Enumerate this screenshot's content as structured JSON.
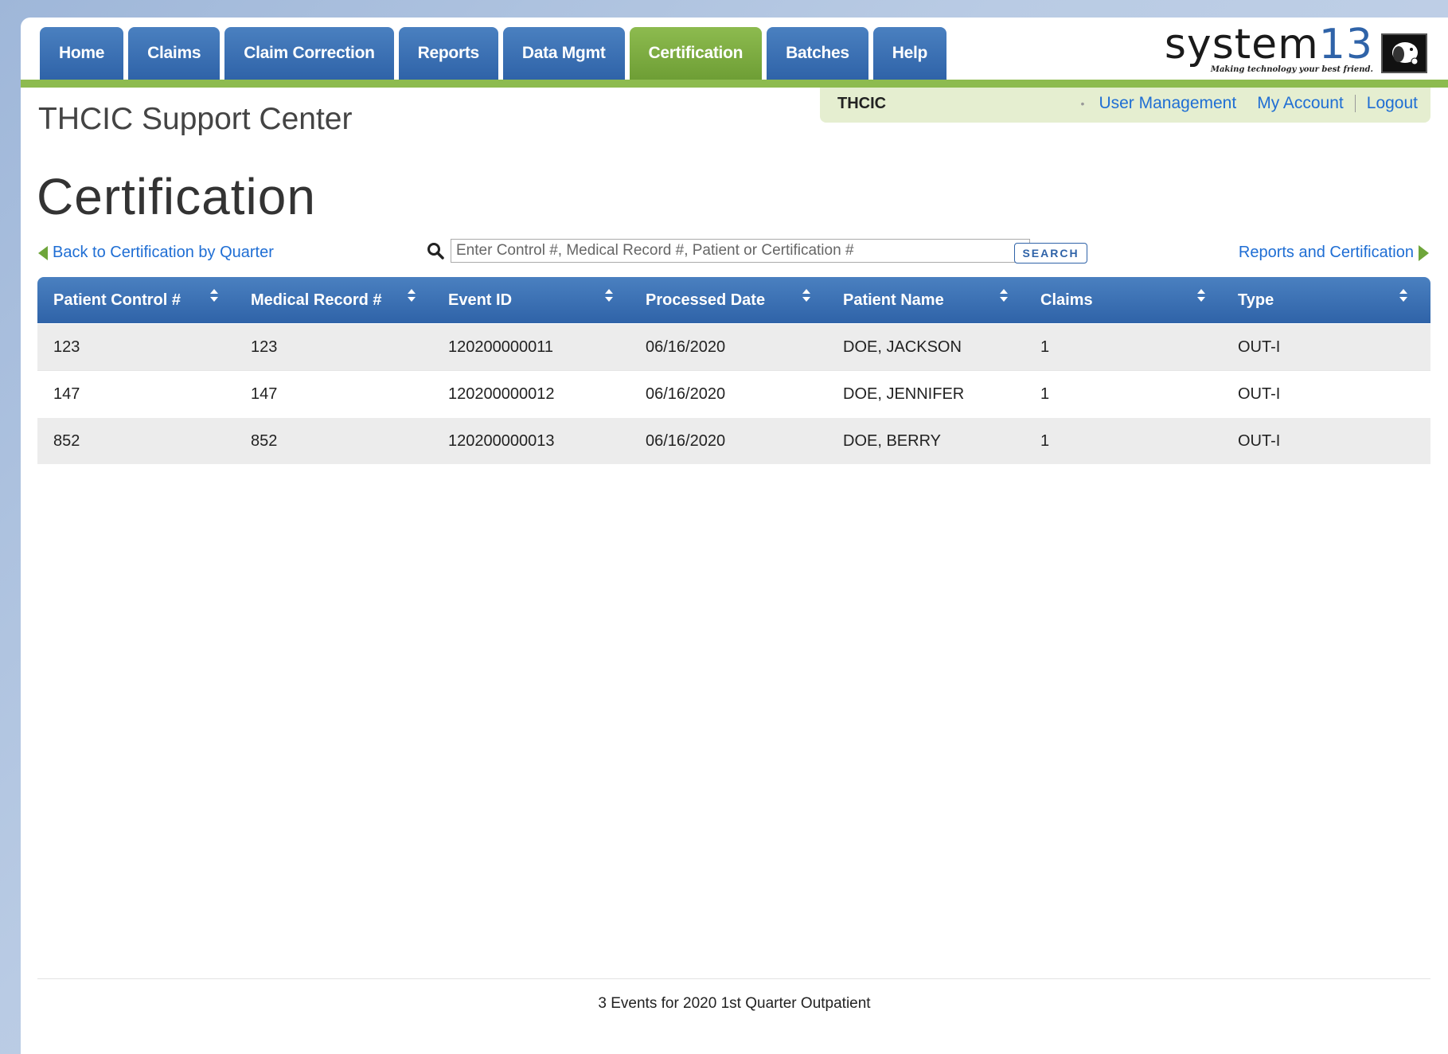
{
  "nav": {
    "tabs": [
      {
        "label": "Home",
        "active": false
      },
      {
        "label": "Claims",
        "active": false
      },
      {
        "label": "Claim Correction",
        "active": false
      },
      {
        "label": "Reports",
        "active": false
      },
      {
        "label": "Data Mgmt",
        "active": false
      },
      {
        "label": "Certification",
        "active": true
      },
      {
        "label": "Batches",
        "active": false
      },
      {
        "label": "Help",
        "active": false
      }
    ]
  },
  "logo": {
    "word": "system",
    "number": "13",
    "tagline": "Making technology your best friend.",
    "icon": "dog-logo-icon"
  },
  "userbar": {
    "org": "THCIC",
    "user_management": "User Management",
    "my_account": "My Account",
    "logout": "Logout"
  },
  "site_title": "THCIC Support Center",
  "page_title": "Certification",
  "toolbar": {
    "back_link": "Back to Certification by Quarter",
    "search_placeholder": "Enter Control #, Medical Record #, Patient or Certification #",
    "search_value": "",
    "search_button": "SEARCH",
    "reports_link": "Reports and Certification"
  },
  "table": {
    "columns": [
      "Patient Control #",
      "Medical Record #",
      "Event ID",
      "Processed Date",
      "Patient Name",
      "Claims",
      "Type"
    ],
    "rows": [
      [
        "123",
        "123",
        "120200000011",
        "06/16/2020",
        "DOE, JACKSON",
        "1",
        "OUT-I"
      ],
      [
        "147",
        "147",
        "120200000012",
        "06/16/2020",
        "DOE, JENNIFER",
        "1",
        "OUT-I"
      ],
      [
        "852",
        "852",
        "120200000013",
        "06/16/2020",
        "DOE, BERRY",
        "1",
        "OUT-I"
      ]
    ]
  },
  "footer": "3 Events for 2020 1st Quarter Outpatient",
  "colors": {
    "nav_blue": "#2f63a8",
    "nav_green": "#8dbb4f",
    "link_blue": "#1f6ed4",
    "arrow_green": "#6ea53a"
  }
}
